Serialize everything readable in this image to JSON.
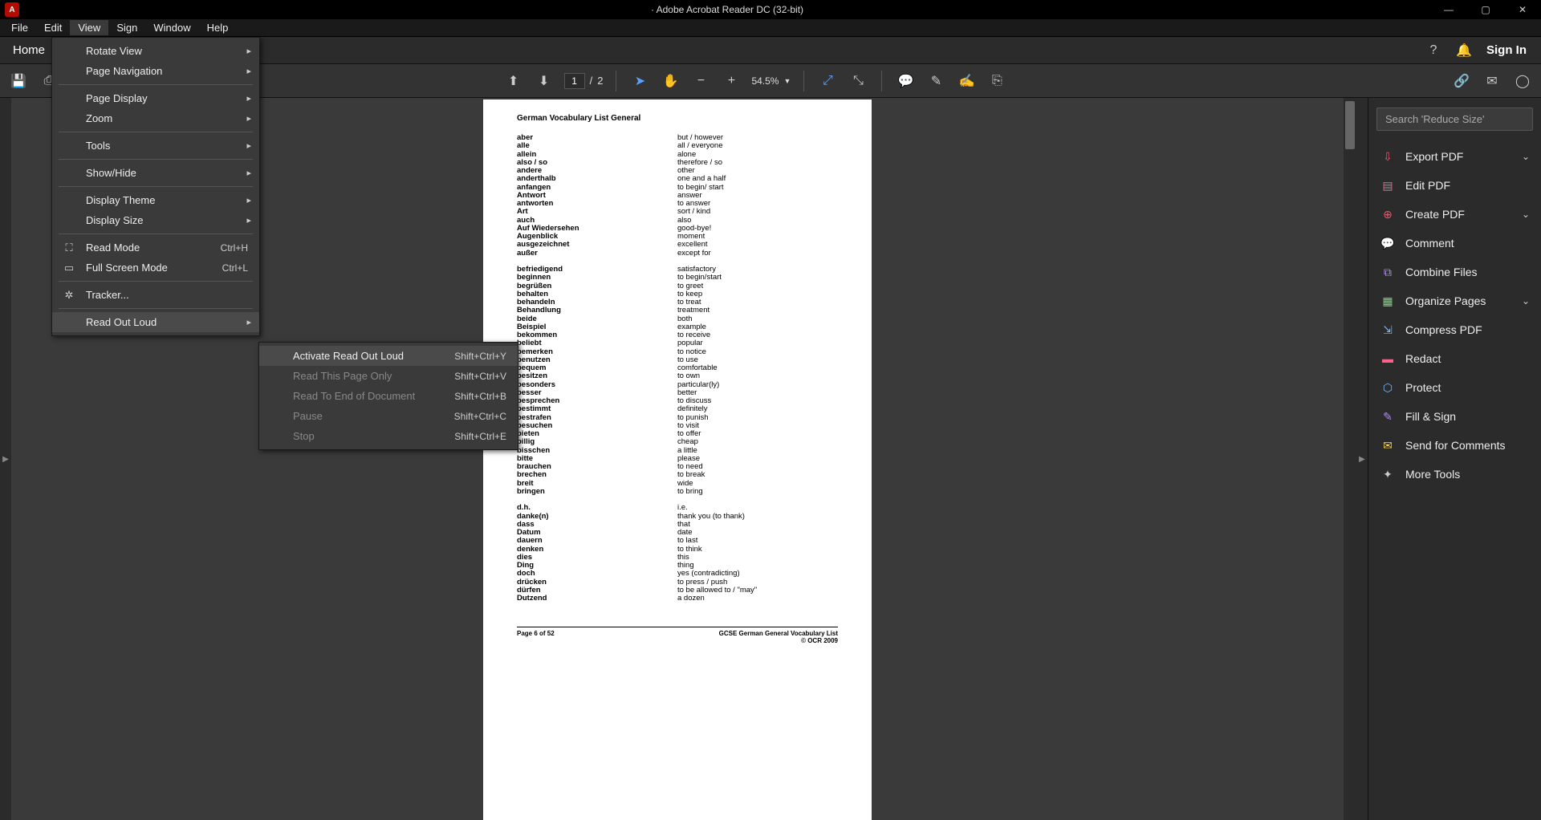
{
  "titlebar": {
    "title": "· Adobe Acrobat Reader DC (32-bit)"
  },
  "menubar": {
    "items": [
      "File",
      "Edit",
      "View",
      "Sign",
      "Window",
      "Help"
    ],
    "active_index": 2
  },
  "homerow": {
    "home": "Home",
    "sign_in": "Sign In"
  },
  "toolbar": {
    "page_current": "1",
    "page_sep": "/",
    "page_total": "2",
    "zoom": "54.5%"
  },
  "view_menu": {
    "items": [
      {
        "label": "Rotate View",
        "sub": true
      },
      {
        "label": "Page Navigation",
        "sub": true
      },
      {
        "sep": true
      },
      {
        "label": "Page Display",
        "sub": true
      },
      {
        "label": "Zoom",
        "sub": true
      },
      {
        "sep": true
      },
      {
        "label": "Tools",
        "sub": true
      },
      {
        "sep": true
      },
      {
        "label": "Show/Hide",
        "sub": true
      },
      {
        "sep": true
      },
      {
        "label": "Display Theme",
        "sub": true
      },
      {
        "label": "Display Size",
        "sub": true
      },
      {
        "sep": true
      },
      {
        "label": "Read Mode",
        "kbd": "Ctrl+H",
        "icon": "⛶"
      },
      {
        "label": "Full Screen Mode",
        "kbd": "Ctrl+L",
        "icon": "▭"
      },
      {
        "sep": true
      },
      {
        "label": "Tracker...",
        "icon": "✲"
      },
      {
        "sep": true
      },
      {
        "label": "Read Out Loud",
        "sub": true,
        "highlight": true
      }
    ]
  },
  "readout_menu": {
    "items": [
      {
        "label": "Activate Read Out Loud",
        "kbd": "Shift+Ctrl+Y",
        "highlight": true
      },
      {
        "label": "Read This Page Only",
        "kbd": "Shift+Ctrl+V",
        "disabled": true
      },
      {
        "label": "Read To End of Document",
        "kbd": "Shift+Ctrl+B",
        "disabled": true
      },
      {
        "label": "Pause",
        "kbd": "Shift+Ctrl+C",
        "disabled": true
      },
      {
        "label": "Stop",
        "kbd": "Shift+Ctrl+E",
        "disabled": true
      }
    ]
  },
  "right_panel": {
    "search_placeholder": "Search 'Reduce Size'",
    "tools": [
      {
        "label": "Export PDF",
        "color": "c-red",
        "glyph": "⇩",
        "chev": true
      },
      {
        "label": "Edit PDF",
        "color": "c-pink",
        "glyph": "▤"
      },
      {
        "label": "Create PDF",
        "color": "c-red",
        "glyph": "⊕",
        "chev": true
      },
      {
        "label": "Comment",
        "color": "c-yellow",
        "glyph": "💬"
      },
      {
        "label": "Combine Files",
        "color": "c-purple",
        "glyph": "⧉"
      },
      {
        "label": "Organize Pages",
        "color": "c-green",
        "glyph": "▦",
        "chev": true
      },
      {
        "label": "Compress PDF",
        "color": "c-blue",
        "glyph": "⇲"
      },
      {
        "label": "Redact",
        "color": "c-pink",
        "glyph": "▬"
      },
      {
        "label": "Protect",
        "color": "c-blue",
        "glyph": "⬡"
      },
      {
        "label": "Fill & Sign",
        "color": "c-purple",
        "glyph": "✎"
      },
      {
        "label": "Send for Comments",
        "color": "c-yellow",
        "glyph": "✉"
      },
      {
        "label": "More Tools",
        "color": "c-gray",
        "glyph": "✦"
      }
    ]
  },
  "document": {
    "title": "German Vocabulary List General",
    "footer_left": "Page 6 of 52",
    "footer_right1": "GCSE German General Vocabulary List",
    "footer_right2": "© OCR 2009",
    "rows": [
      [
        "aber",
        "but / however"
      ],
      [
        "alle",
        "all / everyone"
      ],
      [
        "allein",
        "alone"
      ],
      [
        "also / so",
        "therefore / so"
      ],
      [
        "andere",
        "other"
      ],
      [
        "anderthalb",
        "one and a half"
      ],
      [
        "anfangen",
        "to begin/ start"
      ],
      [
        "Antwort",
        "answer"
      ],
      [
        "antworten",
        "to answer"
      ],
      [
        "Art",
        "sort / kind"
      ],
      [
        "auch",
        "also"
      ],
      [
        "Auf Wiedersehen",
        "good-bye!"
      ],
      [
        "Augenblick",
        "moment"
      ],
      [
        "ausgezeichnet",
        "excellent"
      ],
      [
        "außer",
        "except for"
      ],
      [
        "",
        ""
      ],
      [
        "befriedigend",
        "satisfactory"
      ],
      [
        "beginnen",
        "to begin/start"
      ],
      [
        "begrüßen",
        "to greet"
      ],
      [
        "behalten",
        "to keep"
      ],
      [
        "behandeln",
        "to treat"
      ],
      [
        "Behandlung",
        "treatment"
      ],
      [
        "beide",
        "both"
      ],
      [
        "Beispiel",
        "example"
      ],
      [
        "bekommen",
        "to receive"
      ],
      [
        "beliebt",
        "popular"
      ],
      [
        "bemerken",
        "to notice"
      ],
      [
        "benutzen",
        "to use"
      ],
      [
        "bequem",
        "comfortable"
      ],
      [
        "besitzen",
        "to own"
      ],
      [
        "besonders",
        "particular(ly)"
      ],
      [
        "besser",
        "better"
      ],
      [
        "besprechen",
        "to discuss"
      ],
      [
        "bestimmt",
        "definitely"
      ],
      [
        "bestrafen",
        "to punish"
      ],
      [
        "besuchen",
        "to visit"
      ],
      [
        "bieten",
        "to offer"
      ],
      [
        "billig",
        "cheap"
      ],
      [
        "bisschen",
        "a little"
      ],
      [
        "bitte",
        "please"
      ],
      [
        "brauchen",
        "to need"
      ],
      [
        "brechen",
        "to break"
      ],
      [
        "breit",
        "wide"
      ],
      [
        "bringen",
        "to bring"
      ],
      [
        "",
        ""
      ],
      [
        "d.h.",
        "i.e."
      ],
      [
        "danke(n)",
        "thank you (to thank)"
      ],
      [
        "dass",
        "that"
      ],
      [
        "Datum",
        "date"
      ],
      [
        "dauern",
        "to last"
      ],
      [
        "denken",
        "to think"
      ],
      [
        "dies",
        "this"
      ],
      [
        "Ding",
        "thing"
      ],
      [
        "doch",
        "yes (contradicting)"
      ],
      [
        "drücken",
        "to press / push"
      ],
      [
        "dürfen",
        "to be allowed to / \"may\""
      ],
      [
        "Dutzend",
        "a dozen"
      ]
    ]
  }
}
